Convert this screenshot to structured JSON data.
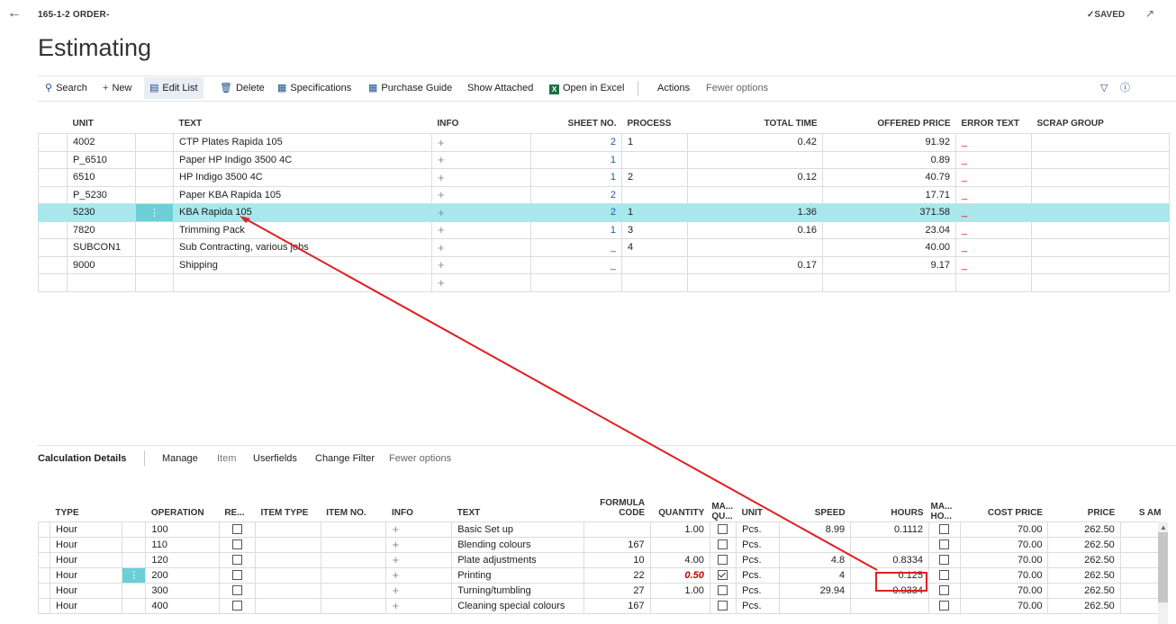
{
  "header": {
    "back_icon": "back-arrow-icon",
    "breadcrumb": "165-1-2 ORDER-",
    "saved": "SAVED",
    "title": "Estimating"
  },
  "actions": {
    "search": "Search",
    "new": "New",
    "edit_list": "Edit List",
    "delete": "Delete",
    "specifications": "Specifications",
    "purchase_guide": "Purchase Guide",
    "show_attached": "Show Attached",
    "open_in_excel": "Open in Excel",
    "actions": "Actions",
    "fewer_options": "Fewer options"
  },
  "main_grid": {
    "columns": [
      "UNIT",
      "TEXT",
      "INFO",
      "SHEET NO.",
      "PROCESS",
      "TOTAL TIME",
      "OFFERED PRICE",
      "ERROR TEXT",
      "SCRAP GROUP"
    ],
    "rows": [
      {
        "unit": "4002",
        "text": "CTP Plates Rapida 105",
        "info": "+",
        "sheet": "2",
        "process": "1",
        "time": "0.42",
        "price": "91.92",
        "err": "_"
      },
      {
        "unit": "P_6510",
        "text": "Paper HP Indigo 3500 4C",
        "info": "+",
        "sheet": "1",
        "process": "",
        "time": "",
        "price": "0.89",
        "err": "_"
      },
      {
        "unit": "6510",
        "text": "HP Indigo 3500 4C",
        "info": "+",
        "sheet": "1",
        "process": "2",
        "time": "0.12",
        "price": "40.79",
        "err": "_"
      },
      {
        "unit": "P_5230",
        "text": "Paper KBA Rapida 105",
        "info": "+",
        "sheet": "2",
        "process": "",
        "time": "",
        "price": "17.71",
        "err": "_"
      },
      {
        "unit": "5230",
        "text": "KBA Rapida 105",
        "info": "+",
        "sheet": "2",
        "process": "1",
        "time": "1.36",
        "price": "371.58",
        "err": "_"
      },
      {
        "unit": "7820",
        "text": "Trimming Pack",
        "info": "+",
        "sheet": "1",
        "process": "3",
        "time": "0.16",
        "price": "23.04",
        "err": "_"
      },
      {
        "unit": "SUBCON1",
        "text": "Sub Contracting, various jobs",
        "info": "+",
        "sheet": "_",
        "process": "4",
        "time": "",
        "price": "40.00",
        "err": "_"
      },
      {
        "unit": "9000",
        "text": "Shipping",
        "info": "+",
        "sheet": "_",
        "process": "",
        "time": "0.17",
        "price": "9.17",
        "err": "_"
      },
      {
        "unit": "",
        "text": "",
        "info": "+",
        "sheet": "",
        "process": "",
        "time": "",
        "price": "",
        "err": ""
      }
    ]
  },
  "calc": {
    "title": "Calculation Details",
    "manage": "Manage",
    "item": "Item",
    "userfields": "Userfields",
    "change_filter": "Change Filter",
    "fewer_options": "Fewer options",
    "columns": [
      "TYPE",
      "OPERATION",
      "RE...",
      "ITEM TYPE",
      "ITEM NO.",
      "INFO",
      "TEXT",
      "FORMULA CODE",
      "QUANTITY",
      "MA... QU...",
      "UNIT",
      "SPEED",
      "HOURS",
      "MA... HO...",
      "COST PRICE",
      "PRICE",
      "S AM"
    ],
    "rows": [
      {
        "type": "Hour",
        "op": "100",
        "info": "+",
        "text": "Basic Set up",
        "formula": "",
        "qty": "1.00",
        "unit": "Pcs.",
        "speed": "8.99",
        "hours": "0.1112",
        "cost": "70.00",
        "price": "262.50"
      },
      {
        "type": "Hour",
        "op": "110",
        "info": "+",
        "text": "Blending colours",
        "formula": "167",
        "qty": "",
        "unit": "Pcs.",
        "speed": "",
        "hours": "",
        "cost": "70.00",
        "price": "262.50"
      },
      {
        "type": "Hour",
        "op": "120",
        "info": "+",
        "text": "Plate adjustments",
        "formula": "10",
        "qty": "4.00",
        "unit": "Pcs.",
        "speed": "4.8",
        "hours": "0.8334",
        "cost": "70.00",
        "price": "262.50"
      },
      {
        "type": "Hour",
        "op": "200",
        "info": "+",
        "text": "Printing",
        "formula": "22",
        "qty": "0.50",
        "unit": "Pcs.",
        "speed": "4",
        "hours": "0.125",
        "cost": "70.00",
        "price": "262.50"
      },
      {
        "type": "Hour",
        "op": "300",
        "info": "+",
        "text": "Turning/tumbling",
        "formula": "27",
        "qty": "1.00",
        "unit": "Pcs.",
        "speed": "29.94",
        "hours": "0.0334",
        "cost": "70.00",
        "price": "262.50"
      },
      {
        "type": "Hour",
        "op": "400",
        "info": "+",
        "text": "Cleaning special colours",
        "formula": "167",
        "qty": "",
        "unit": "Pcs.",
        "speed": "",
        "hours": "",
        "cost": "70.00",
        "price": "262.50"
      }
    ]
  },
  "colors": {
    "selection": "#a9e7ec",
    "dots": "#6ccfd8",
    "annotation": "#e02020"
  }
}
